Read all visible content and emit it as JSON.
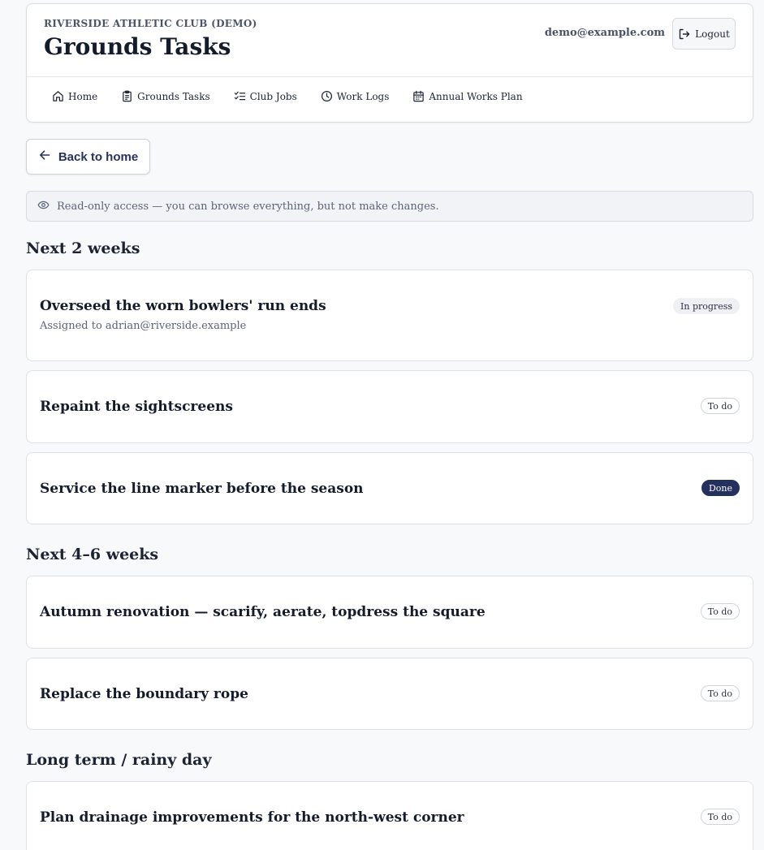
{
  "header": {
    "club_name": "RIVERSIDE ATHLETIC CLUB (DEMO)",
    "title": "Grounds Tasks",
    "user_email": "demo@example.com",
    "logout_label": "Logout"
  },
  "nav": {
    "items": [
      {
        "label": "Home",
        "icon": "home-icon"
      },
      {
        "label": "Grounds Tasks",
        "icon": "clipboard-icon"
      },
      {
        "label": "Club Jobs",
        "icon": "checklist-icon"
      },
      {
        "label": "Work Logs",
        "icon": "clock-icon"
      },
      {
        "label": "Annual Works Plan",
        "icon": "calendar-icon"
      }
    ]
  },
  "back_button": {
    "label": "Back to home",
    "icon": "arrow-left-icon"
  },
  "notice": {
    "icon": "eye-icon",
    "text": "Read-only access — you can browse everything, but not make changes."
  },
  "sections": [
    {
      "title": "Next 2 weeks",
      "tasks": [
        {
          "title": "Overseed the worn bowlers' run ends",
          "assignee": "Assigned to adrian@riverside.example",
          "status": "In progress"
        },
        {
          "title": "Repaint the sightscreens",
          "status": "To do"
        },
        {
          "title": "Service the line marker before the season",
          "status": "Done"
        }
      ]
    },
    {
      "title": "Next 4–6 weeks",
      "tasks": [
        {
          "title": "Autumn renovation — scarify, aerate, topdress the square",
          "status": "To do"
        },
        {
          "title": "Replace the boundary rope",
          "status": "To do"
        }
      ]
    },
    {
      "title": "Long term / rainy day",
      "tasks": [
        {
          "title": "Plan drainage improvements for the north-west corner",
          "status": "To do"
        }
      ]
    }
  ],
  "colors": {
    "accent": "#24305e",
    "background": "#f8f9fb",
    "card_border": "#dde1e7"
  }
}
